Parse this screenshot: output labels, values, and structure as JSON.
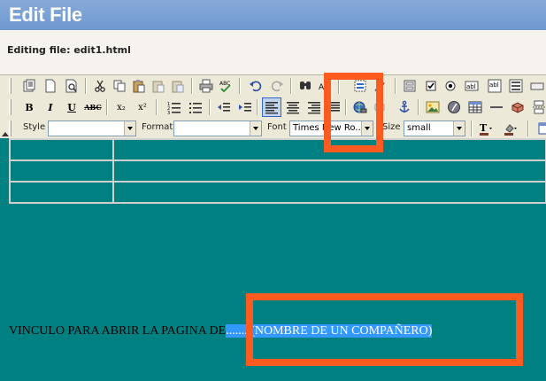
{
  "window": {
    "title": "Edit File"
  },
  "editing": {
    "label": "Editing file: edit1.html"
  },
  "toolbar": {
    "style_label": "Style",
    "format_label": "Format",
    "font_label": "Font",
    "font_value": "Times New Ro...",
    "size_label": "Size",
    "size_value": "small",
    "bold": "B",
    "italic": "I",
    "underline": "U",
    "strike": "ABC",
    "subscript": "x₂",
    "superscript": "x²",
    "spellcheck": "ABC"
  },
  "document": {
    "text_before": "VINCULO PARA ABRIR LA PAGINA DE",
    "selected_text": "........(NOMBRE DE UN COMPAÑERO)"
  },
  "colors": {
    "highlight": "#ff5a1f",
    "content_bg": "#008080",
    "title_bg": "#7a9fd4",
    "selection": "#3399ff"
  }
}
